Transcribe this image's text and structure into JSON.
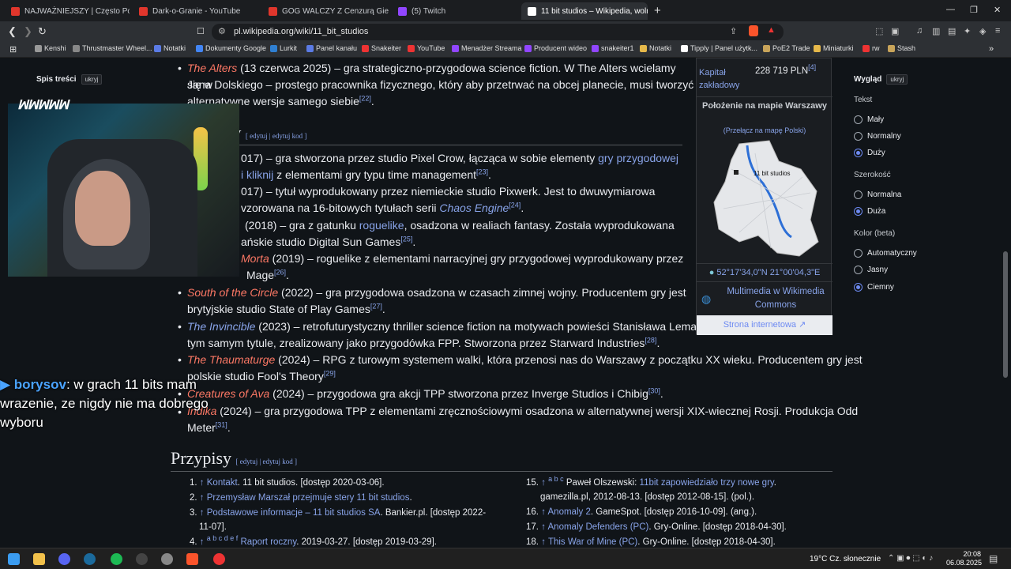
{
  "tabs": [
    {
      "title": "NAJWAŻNIEJSZY | Często Pomijany A",
      "color": "#e0362c"
    },
    {
      "title": "Dark-o-Granie - YouTube",
      "color": "#e0362c"
    },
    {
      "title": "GOG WALCZY Z Cenzurą Gier — Bio",
      "color": "#e0362c"
    },
    {
      "title": "(5) Twitch",
      "color": "#9146ff"
    },
    {
      "title": "11 bit studios – Wikipedia, woln",
      "color": "#ffffff"
    }
  ],
  "window_controls": {
    "minimize": "—",
    "maximize": "❐",
    "close": "✕"
  },
  "new_tab": "+",
  "url": "pl.wikipedia.org/wiki/11_bit_studios",
  "bookmarks": [
    {
      "label": "Kenshi",
      "color": "#999"
    },
    {
      "label": "Thrustmaster Wheel...",
      "color": "#888"
    },
    {
      "label": "Notatki",
      "color": "#5b7be5"
    },
    {
      "label": "Dokumenty Google",
      "color": "#4285f4"
    },
    {
      "label": "Lurkit",
      "color": "#2f7fd1"
    },
    {
      "label": "Panel kanału",
      "color": "#5b7be5"
    },
    {
      "label": "Snakeiter",
      "color": "#e33"
    },
    {
      "label": "YouTube",
      "color": "#e33"
    },
    {
      "label": "Menadżer Streama",
      "color": "#9146ff"
    },
    {
      "label": "Producent wideo",
      "color": "#9146ff"
    },
    {
      "label": "snakeiter1",
      "color": "#9146ff"
    },
    {
      "label": "Notatki",
      "color": "#e5b84a"
    },
    {
      "label": "Tipply | Panel użytk...",
      "color": "#fff"
    },
    {
      "label": "PoE2 Trade",
      "color": "#c8a45a"
    },
    {
      "label": "Miniaturki",
      "color": "#e5b84a"
    },
    {
      "label": "rw",
      "color": "#e33"
    },
    {
      "label": "Stash",
      "color": "#c8a45a"
    }
  ],
  "toc": {
    "title": "Spis treści",
    "hide": "ukryj"
  },
  "stream": {
    "logo": "ꟽꟽꟽꟽꟽ",
    "chat_user": "borysov",
    "chat_msg": ": w grach 11 bits mam wrazenie, ze nigdy nie ma dobrego wyboru"
  },
  "article": {
    "p_alters_title": "The Alters",
    "p_alters_rest": " (13 czerwca 2025) – gra strategiczno-przygodowa science fiction. W The Alters wcielamy się w",
    "p_alters_l2": "Jana Dolskiego – prostego pracownika fizycznego, który aby przetrwać na obcej planecie, musi tworzyć",
    "p_alters_l3": "alternatywne wersje samego siebie",
    "p_alters_ref": "[22]",
    "sec_title": "ry",
    "sec_edit": "[ edytuj | edytuj kod ]",
    "l1a": "017) – gra stworzona przez studio Pixel Crow, łącząca w sobie elementy ",
    "l1link": "gry przygodowej",
    "l1b_link": "i kliknij",
    "l1b": " z elementami gry typu time management",
    "l1ref": "[23]",
    "l2a": "017) – tytuł wyprodukowany przez niemieckie studio Pixwerk. Jest to dwuwymiarowa",
    "l2b": "vzorowana na 16-bitowych tytułach serii ",
    "l2link": "Chaos Engine",
    "l2ref": "[24]",
    "l3a": "(2018) – gra z gatunku ",
    "l3link": "roguelike",
    "l3a2": ", osadzona w realiach fantasy. Została wyprodukowana",
    "l3b": "ańskie studio Digital Sun Games",
    "l3ref": "[25]",
    "l4title": "Morta",
    "l4a": " (2019) – roguelike z elementami narracyjnej gry przygodowej wyprodukowany przez",
    "l4b": "Mage",
    "l4ref": "[26]",
    "l5title": "South of the Circle",
    "l5a": " (2022) – gra przygodowa osadzona w czasach zimnej wojny. Producentem gry jest",
    "l5b": "brytyjskie studio State of Play Games",
    "l5ref": "[27]",
    "l6title": "The Invincible",
    "l6a": " (2023) – retrofuturystyczny thriller science fiction na motywach powieści Stanisława Lema o",
    "l6b": "tym samym tytule, zrealizowany jako przygodówka FPP. Stworzona przez Starward Industries",
    "l6ref": "[28]",
    "l7title": "The Thaumaturge",
    "l7a": " (2024) – RPG z turowym systemem walki, która przenosi nas do Warszawy z początku XX wieku. Producentem gry jest",
    "l7b": "polskie studio Fool's Theory",
    "l7ref": "[29]",
    "l8title": "Creatures of Ava",
    "l8a": " (2024) – przygodowa gra akcji TPP stworzona przez Inverge Studios i Chibig",
    "l8ref": "[30]",
    "l9title": "Indika",
    "l9a": " (2024) – gra przygodowa TPP z elementami zręcznościowymi osadzona w alternatywnej wersji XIX-wiecznej Rosji. Produkcja Odd",
    "l9b": "Meter",
    "l9ref": "[31]",
    "przypisy": "Przypisy",
    "przypisy_edit": "[ edytuj | edytuj kod ]"
  },
  "refs_left": [
    {
      "n": "1.",
      "arrow": "↑",
      "link": "Kontakt",
      "rest": ". 11 bit studios. [dostęp 2020-03-06]."
    },
    {
      "n": "2.",
      "arrow": "↑",
      "link": "Przemysław Marszał przejmuje stery 11 bit studios",
      "rest": "."
    },
    {
      "n": "3.",
      "arrow": "↑",
      "link": "Podstawowe informacje – 11 bit studios SA",
      "rest": ". Bankier.pl. [dostęp 2022-",
      "rest2": "11-07]."
    },
    {
      "n": "4.",
      "arrow": "↑",
      "letters": "a b c d e f",
      "link": "Raport roczny",
      "rest": ". 2019-03-27. [dostęp 2019-03-29]."
    }
  ],
  "refs_right": [
    {
      "n": "15.",
      "arrow": "↑",
      "letters": "a b c",
      "pre": "Paweł Olszewski: ",
      "link": "11bit zapowiedziało trzy nowe gry",
      "rest": ".",
      "rest2": "gamezilla.pl, 2012-08-13. [dostęp 2012-08-15]. (pol.)."
    },
    {
      "n": "16.",
      "arrow": "↑",
      "link": "Anomaly 2",
      "rest": ". GameSpot. [dostęp 2016-10-09]. (ang.)."
    },
    {
      "n": "17.",
      "arrow": "↑",
      "link": "Anomaly Defenders (PC)",
      "rest": ". Gry-Online. [dostęp 2018-04-30]."
    },
    {
      "n": "18.",
      "arrow": "↑",
      "link": "This War of Mine (PC)",
      "rest": ". Gry-Online. [dostęp 2018-04-30]."
    }
  ],
  "infobox": {
    "kapital_label": "Kapitał zakładowy",
    "kapital_value": "228 719 PLN",
    "kapital_ref": "[4]",
    "map_title": "Położenie na mapie Warszawy",
    "map_switch": "(Przełącz na mapę Polski)",
    "map_marker": "11 bit studios",
    "coords": "52°17'34,0\"N 21°00'04,3\"E",
    "commons": "Multimedia w Wikimedia Commons",
    "website": "Strona internetowa"
  },
  "appearance": {
    "title": "Wygląd",
    "hide": "ukryj",
    "text_label": "Tekst",
    "text_opts": [
      "Mały",
      "Normalny",
      "Duży"
    ],
    "text_selected": 2,
    "width_label": "Szerokość",
    "width_opts": [
      "Normalna",
      "Duża"
    ],
    "width_selected": 1,
    "color_label": "Kolor (beta)",
    "color_opts": [
      "Automatyczny",
      "Jasny",
      "Ciemny"
    ],
    "color_selected": 2
  },
  "taskbar": {
    "weather": "19°C  Cz. słonecznie",
    "time": "20:08",
    "date": "06.08.2025",
    "icons": [
      {
        "name": "windows",
        "color": "#3b9cf0"
      },
      {
        "name": "explorer",
        "color": "#f2c14b"
      },
      {
        "name": "discord",
        "color": "#5865f2"
      },
      {
        "name": "steam",
        "color": "#1b6a9c"
      },
      {
        "name": "spotify",
        "color": "#1db954"
      },
      {
        "name": "obs",
        "color": "#444"
      },
      {
        "name": "app",
        "color": "#888"
      },
      {
        "name": "brave",
        "color": "#fb542b"
      },
      {
        "name": "app2",
        "color": "#e33"
      }
    ]
  }
}
